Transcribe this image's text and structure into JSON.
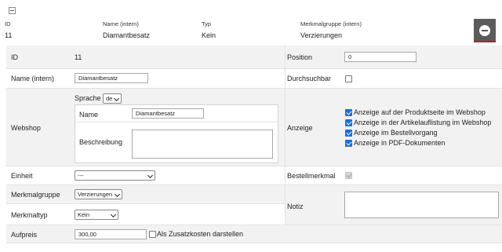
{
  "summary": {
    "headers": {
      "id": "ID",
      "name": "Name (intern)",
      "type": "Typ",
      "group": "Merkmalgruppe (intern)"
    },
    "values": {
      "id": "11",
      "name": "Diamantbesatz",
      "type": "Kein",
      "group": "Verzierungen"
    }
  },
  "form": {
    "id": {
      "label": "ID",
      "value": "11"
    },
    "position": {
      "label": "Position",
      "value": "0"
    },
    "name": {
      "label": "Name (intern)",
      "value": "Diamantbesatz"
    },
    "searchable": {
      "label": "Durchsuchbar",
      "checked": false
    },
    "webshop": {
      "label": "Webshop",
      "language_label": "Sprache",
      "language_value": "de",
      "name_label": "Name",
      "name_value": "Diamantbesatz",
      "description_label": "Beschreibung",
      "description_value": ""
    },
    "display": {
      "label": "Anzeige",
      "options": [
        {
          "label": "Anzeige auf der Produktseite im Webshop",
          "checked": true
        },
        {
          "label": "Anzeige in der Artikelauflistung im Webshop",
          "checked": true
        },
        {
          "label": "Anzeige im Bestellvorgang",
          "checked": true
        },
        {
          "label": "Anzeige in PDF-Dokumenten",
          "checked": true
        }
      ]
    },
    "unit": {
      "label": "Einheit",
      "value": "---"
    },
    "order_feature": {
      "label": "Bestellmerkmal",
      "checked": true,
      "disabled": true
    },
    "group": {
      "label": "Merkmalgruppe",
      "value": "Verzierungen"
    },
    "note": {
      "label": "Notiz",
      "value": ""
    },
    "type": {
      "label": "Merkmaltyp",
      "value": "Kein"
    },
    "surcharge": {
      "label": "Aufpreis",
      "value": "300,00",
      "extra_label": "Als Zusatzkosten darstellen",
      "extra_checked": false
    }
  },
  "colors": {
    "row_alt": "#f2f2f2",
    "border": "#e3e3e3",
    "accent_red": "#c8102e",
    "remove_btn": "#5b5b5b",
    "checkbox": "#1a6fd4"
  }
}
